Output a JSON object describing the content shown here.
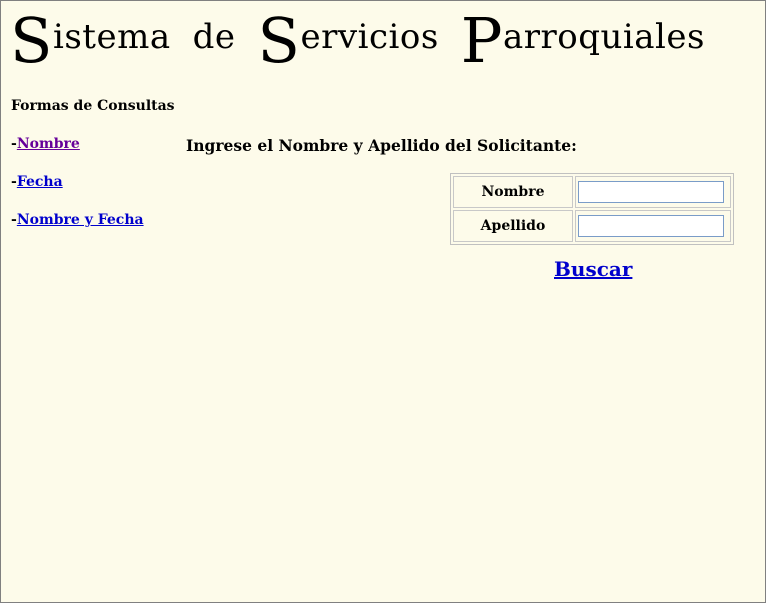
{
  "header": {
    "title_parts": [
      {
        "cap": "S",
        "rest": "istema"
      },
      {
        "cap": "",
        "rest": "de"
      },
      {
        "cap": "S",
        "rest": "ervicios"
      },
      {
        "cap": "P",
        "rest": "arroquiales"
      }
    ]
  },
  "nav": {
    "heading": "Formas de Consultas",
    "prefix": "-",
    "items": [
      {
        "label": "Nombre",
        "visited": true
      },
      {
        "label": "Fecha",
        "visited": false
      },
      {
        "label": "Nombre y Fecha",
        "visited": false
      }
    ]
  },
  "form": {
    "prompt": "Ingrese el Nombre y Apellido del Solicitante:",
    "fields": [
      {
        "label": "Nombre",
        "value": ""
      },
      {
        "label": "Apellido",
        "value": ""
      }
    ],
    "submit_label": "Buscar"
  },
  "colors": {
    "background": "#fdfbea",
    "link": "#0000cc",
    "visited_link": "#660099"
  }
}
